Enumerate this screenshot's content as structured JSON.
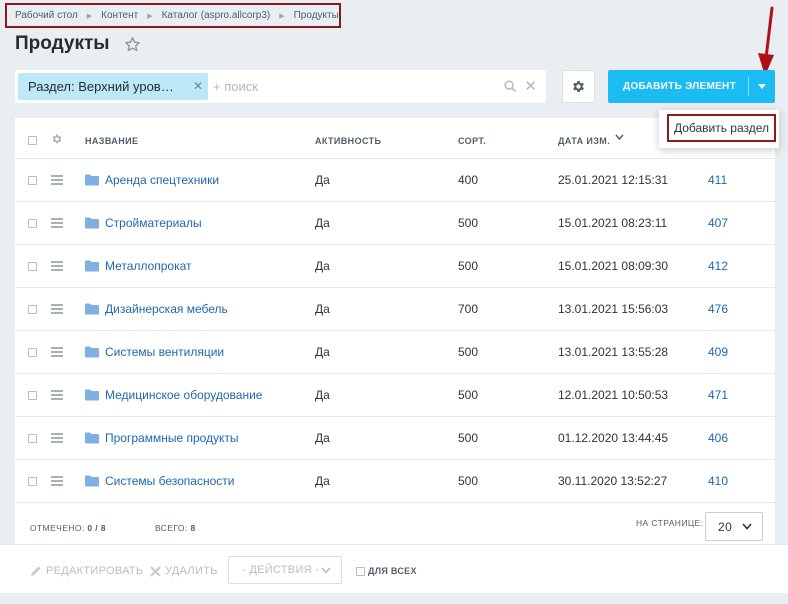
{
  "breadcrumb": [
    "Рабочий стол",
    "Контент",
    "Каталог (aspro.allcorp3)",
    "Продукты"
  ],
  "page": {
    "title": "Продукты"
  },
  "filter": {
    "tag": "Раздел: Верхний уров…",
    "search_placeholder": "+ поиск"
  },
  "toolbar": {
    "add_label": "ДОБАВИТЬ ЭЛЕМЕНТ",
    "dropdown_item": "Добавить раздел"
  },
  "table": {
    "columns": {
      "name": "НАЗВАНИЕ",
      "active": "АКТИВНОСТЬ",
      "sort": "СОРТ.",
      "date": "ДАТА ИЗМ."
    },
    "rows": [
      {
        "name": "Аренда спецтехники",
        "active": "Да",
        "sort": "400",
        "date": "25.01.2021 12:15:31",
        "id": "411"
      },
      {
        "name": "Стройматериалы",
        "active": "Да",
        "sort": "500",
        "date": "15.01.2021 08:23:11",
        "id": "407"
      },
      {
        "name": "Металлопрокат",
        "active": "Да",
        "sort": "500",
        "date": "15.01.2021 08:09:30",
        "id": "412"
      },
      {
        "name": "Дизайнерская мебель",
        "active": "Да",
        "sort": "700",
        "date": "13.01.2021 15:56:03",
        "id": "476"
      },
      {
        "name": "Системы вентиляции",
        "active": "Да",
        "sort": "500",
        "date": "13.01.2021 13:55:28",
        "id": "409"
      },
      {
        "name": "Медицинское оборудование",
        "active": "Да",
        "sort": "500",
        "date": "12.01.2021 10:50:53",
        "id": "471"
      },
      {
        "name": "Программные продукты",
        "active": "Да",
        "sort": "500",
        "date": "01.12.2020 13:44:45",
        "id": "406"
      },
      {
        "name": "Системы безопасности",
        "active": "Да",
        "sort": "500",
        "date": "30.11.2020 13:52:27",
        "id": "410"
      }
    ]
  },
  "footer": {
    "selected_label": "ОТМЕЧЕНО:",
    "selected_value": "0 / 8",
    "total_label": "ВСЕГО:",
    "total_value": "8",
    "per_page_label": "НА СТРАНИЦЕ:",
    "per_page_value": "20"
  },
  "actions": {
    "edit": "РЕДАКТИРОВАТЬ",
    "delete": "УДАЛИТЬ",
    "select": "- ДЕЙСТВИЯ -",
    "for_all": "ДЛЯ ВСЕХ"
  },
  "colors": {
    "accent": "#1bbcf3",
    "link": "#2067b0",
    "highlight": "#8b1a1f",
    "tag": "#bde8f6"
  }
}
